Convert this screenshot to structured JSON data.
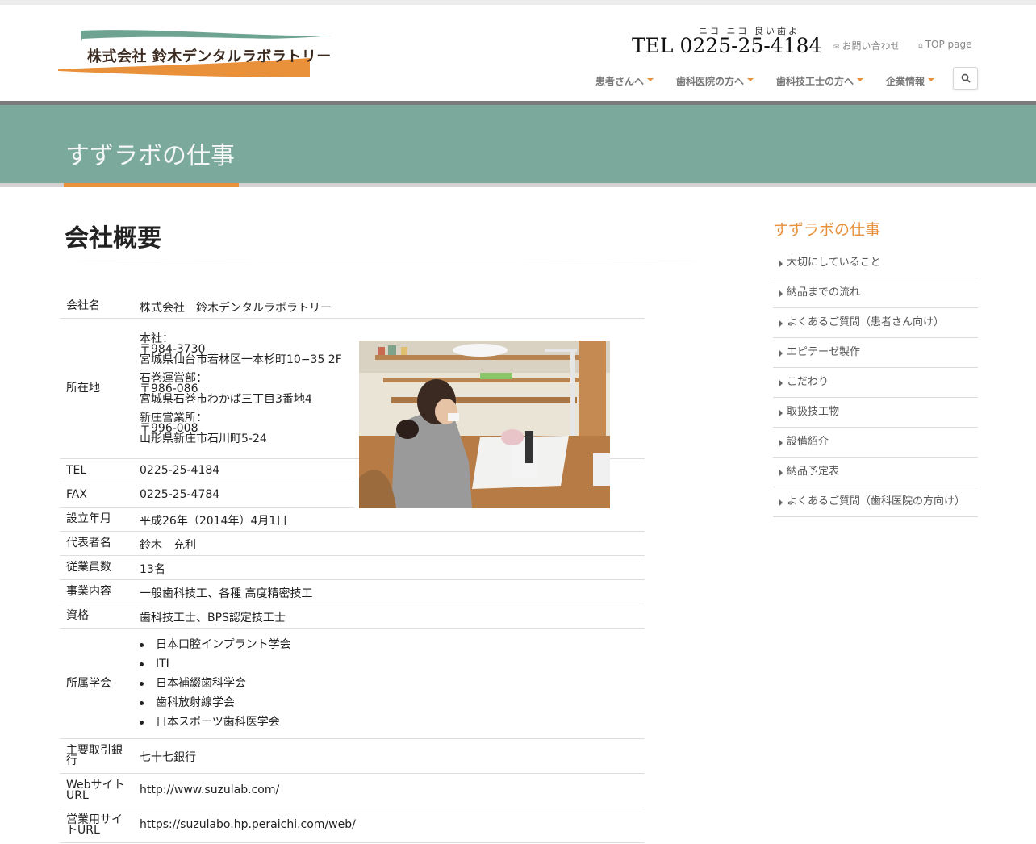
{
  "header": {
    "logo_text": "株式会社 鈴木デンタルラボラトリー",
    "tel_ruby": "ニコ ニコ 良い歯よ",
    "tel": "TEL 0225-25-4184",
    "contact_link": "お問い合わせ",
    "top_link": "TOP page",
    "nav": [
      "患者さんへ",
      "歯科医院の方へ",
      "歯科技工士の方へ",
      "企業情報"
    ]
  },
  "banner": {
    "title": "すずラボの仕事"
  },
  "main": {
    "title": "会社概要",
    "rows": {
      "company": {
        "label": "会社名",
        "value": "株式会社　鈴木デンタルラボラトリー"
      },
      "address": {
        "label": "所在地",
        "offices": [
          {
            "name": "本社：",
            "zip": "〒984-3730",
            "addr": "宮城県仙台市若林区一本杉町10−35 2F"
          },
          {
            "name": "石巻運営部：",
            "zip": "〒986-086",
            "addr": "宮城県石巻市わかば三丁目3番地4"
          },
          {
            "name": "新庄営業所：",
            "zip": "〒996-008",
            "addr": "山形県新庄市石川町5-24"
          }
        ]
      },
      "tel": {
        "label": "TEL",
        "value": "0225-25-4184"
      },
      "fax": {
        "label": "FAX",
        "value": "0225-25-4784"
      },
      "founded": {
        "label": "設立年月",
        "value": "平成26年（2014年）4月1日"
      },
      "rep": {
        "label": "代表者名",
        "value": "鈴木　充利"
      },
      "employees": {
        "label": "従業員数",
        "value": "13名"
      },
      "business": {
        "label": "事業内容",
        "value": "一般歯科技工、各種 高度精密技工"
      },
      "license": {
        "label": "資格",
        "value": "歯科技工士、BPS認定技工士"
      },
      "societies": {
        "label": "所属学会",
        "items": [
          "日本口腔インプラント学会",
          "ITI",
          "日本補綴歯科学会",
          "歯科放射線学会",
          "日本スポーツ歯科医学会"
        ]
      },
      "bank": {
        "label": "主要取引銀行",
        "value": "七十七銀行"
      },
      "website": {
        "label": "WebサイトURL",
        "value": "http://www.suzulab.com/"
      },
      "sales_site": {
        "label": "営業用サイトURL",
        "value": "https://suzulabo.hp.peraichi.com/web/"
      }
    }
  },
  "sidebar": {
    "title": "すずラボの仕事",
    "items": [
      "大切にしていること",
      "納品までの流れ",
      "よくあるご質問（患者さん向け）",
      "エピテーゼ製作",
      "こだわり",
      "取扱技工物",
      "設備紹介",
      "納品予定表",
      "よくあるご質問（歯科医院の方向け）"
    ]
  },
  "colors": {
    "accent": "#e8903a",
    "banner": "#7ba99c",
    "logo_green": "#6fa391"
  },
  "icons": {
    "search": "search-icon",
    "envelope": "envelope-icon",
    "home": "home-icon"
  }
}
